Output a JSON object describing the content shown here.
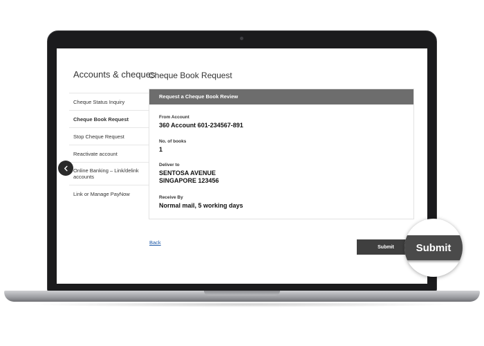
{
  "sidebar": {
    "title": "Accounts & cheques",
    "items": [
      {
        "label": "Cheque Status Inquiry"
      },
      {
        "label": "Cheque Book Request"
      },
      {
        "label": "Stop Cheque Request"
      },
      {
        "label": "Reactivate account"
      },
      {
        "label": "Online Banking – Link/delink accounts"
      },
      {
        "label": "Link or Manage PayNow"
      }
    ],
    "active_index": 1
  },
  "main": {
    "title": "Cheque Book Request",
    "panel": {
      "header": "Request a Cheque Book Review",
      "fields": [
        {
          "label": "From Account",
          "value": "360 Account 601-234567-891"
        },
        {
          "label": "No. of books",
          "value": "1"
        },
        {
          "label": "Deliver to",
          "value_lines": [
            "SENTOSA AVENUE",
            "SINGAPORE 123456"
          ]
        },
        {
          "label": "Receive By",
          "value": "Normal mail, 5 working days"
        }
      ]
    },
    "back_label": "Back",
    "submit_label": "Submit"
  },
  "magnifier": {
    "label": "Submit"
  },
  "colors": {
    "accent": "#1e5aa8",
    "panel_header": "#6d6d6d",
    "button": "#3f3f3f"
  },
  "icons": {
    "collapse": "chevron-left-icon",
    "active_indicator": "triangle-right-icon"
  }
}
